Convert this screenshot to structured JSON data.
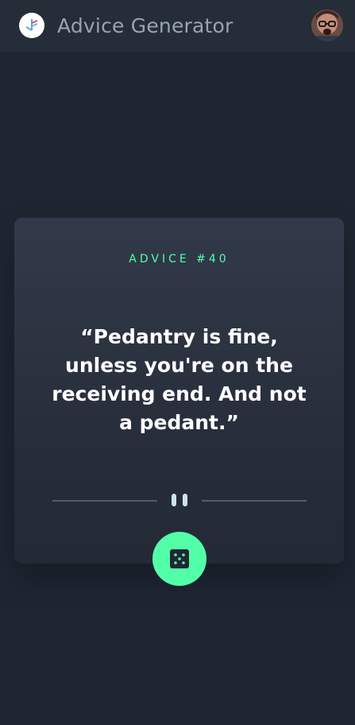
{
  "header": {
    "title": "Advice Generator",
    "logo_icon": "logo-icon",
    "avatar_icon": "user-avatar"
  },
  "card": {
    "advice_label": "ADVICE #40",
    "quote": "“Pedantry is fine, unless you're on the receiving end. And not a pedant.”",
    "divider_icon": "pause-icon",
    "button_icon": "dice-icon"
  },
  "colors": {
    "background": "#1f2632",
    "header": "#252d39",
    "card": "#323a4a",
    "accent": "#52ffa8",
    "text": "#ffffff",
    "muted": "#9aa3b0"
  }
}
